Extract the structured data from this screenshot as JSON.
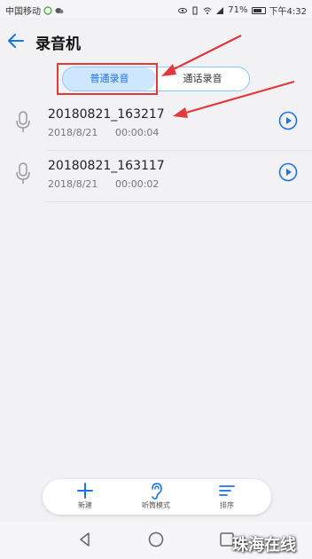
{
  "status_bar": {
    "carrier": "中国移动",
    "battery": "71%",
    "time": "下午4:32"
  },
  "app_bar": {
    "title": "录音机"
  },
  "tabs": {
    "normal": "普通录音",
    "call": "通话录音"
  },
  "recordings": [
    {
      "name": "20180821_163217",
      "date": "2018/8/21",
      "duration": "00:00:04"
    },
    {
      "name": "20180821_163117",
      "date": "2018/8/21",
      "duration": "00:00:02"
    }
  ],
  "bottom_bar": {
    "new_label": "新建",
    "listen_label": "听筒模式",
    "sort_label": "排序"
  },
  "watermark": "珠海在线",
  "colors": {
    "accent": "#1a73e8",
    "annotation_red": "#e03a3a",
    "tab_selected_bg": "#cfe6ff"
  }
}
